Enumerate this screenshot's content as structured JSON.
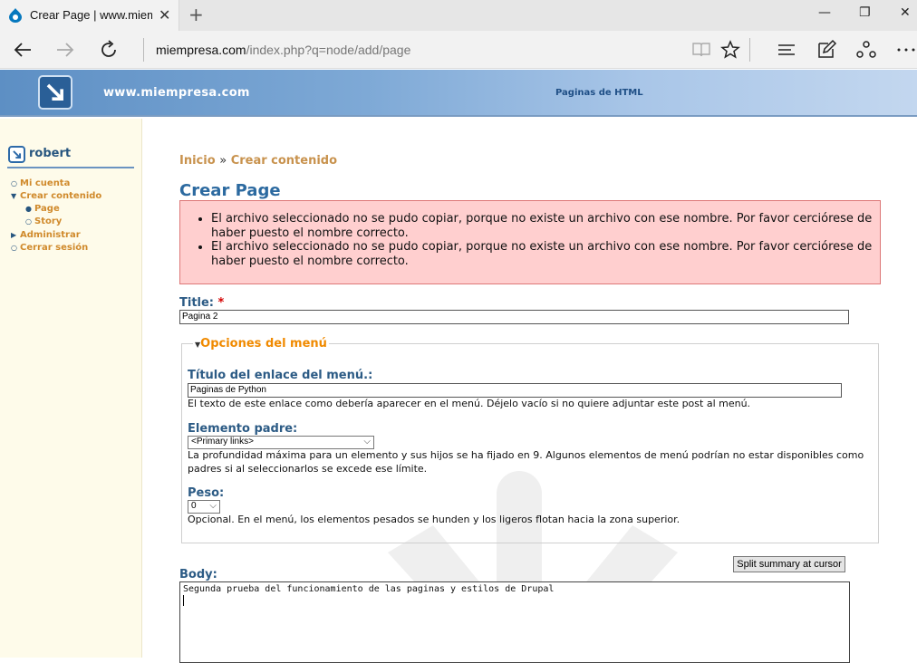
{
  "browser": {
    "tab_title": "Crear Page | www.miem",
    "tab_close": "✕",
    "new_tab": "+",
    "window": {
      "minimize": "—",
      "restore": "❐",
      "close": "✕"
    },
    "url_host": "miempresa.com",
    "url_path": "/index.php?q=node/add/page",
    "icons": [
      "back-arrow-icon",
      "forward-arrow-icon",
      "refresh-icon",
      "reading-view-icon",
      "favorite-star-icon",
      "hub-icon",
      "web-note-icon",
      "share-icon",
      "more-icon"
    ]
  },
  "site": {
    "name": "www.miempresa.com",
    "header_link": "Paginas de HTML"
  },
  "sidebar": {
    "user": "robert",
    "items": [
      {
        "label": "Mi cuenta"
      },
      {
        "label": "Crear contenido"
      },
      {
        "label": "Page"
      },
      {
        "label": "Story"
      },
      {
        "label": "Administrar"
      },
      {
        "label": "Cerrar sesión"
      }
    ]
  },
  "main": {
    "breadcrumb": {
      "home": "Inicio",
      "sep": "»",
      "current": "Crear contenido"
    },
    "title": "Crear Page",
    "errors": [
      "El archivo seleccionado no se pudo copiar, porque no existe un archivo con ese nombre. Por favor cerciórese de haber puesto el nombre correcto.",
      "El archivo seleccionado no se pudo copiar, porque no existe un archivo con ese nombre. Por favor cerciórese de haber puesto el nombre correcto."
    ],
    "title_field": {
      "label": "Title:",
      "required": "*",
      "value": "Pagina 2"
    },
    "menu_settings": {
      "legend": "Opciones del menú",
      "link_title_label": "Título del enlace del menú.:",
      "link_title_value": "Paginas de Python",
      "link_title_desc": "El texto de este enlace como debería aparecer en el menú. Déjelo vacío si no quiere adjuntar este post al menú.",
      "parent_label": "Elemento padre:",
      "parent_value": "<Primary links>",
      "parent_desc": "La profundidad máxima para un elemento y sus hijos se ha fijado en 9. Algunos elementos de menú podrían no estar disponibles como padres si al seleccionarlos se excede ese límite.",
      "weight_label": "Peso:",
      "weight_value": "0",
      "weight_desc": "Opcional. En el menú, los elementos pesados se hunden y los ligeros flotan hacia la zona superior."
    },
    "split_button": "Split summary at cursor",
    "body_label": "Body:",
    "body_value": "Segunda prueba del funcionamiento de las paginas y estilos de Drupal"
  },
  "colors": {
    "error_bg": "#ffcfcf",
    "error_border": "#dd7777",
    "link": "#c8924d",
    "heading": "#2c6aa0",
    "legend": "#f08a00",
    "sidebar_bg": "#fefbea"
  }
}
